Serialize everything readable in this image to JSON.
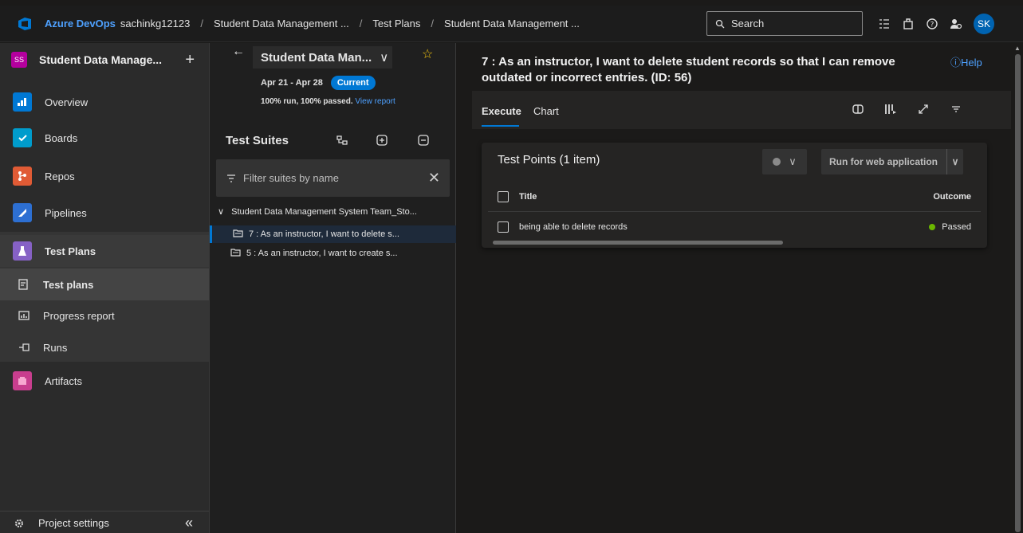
{
  "topbar": {
    "brand": "Azure DevOps",
    "org": "sachinkg12123",
    "breadcrumb": [
      "Student Data Management ...",
      "Test Plans",
      "Student Data Management ..."
    ],
    "search_placeholder": "Search",
    "avatar_initials": "SK"
  },
  "sidebar": {
    "project_badge": "SS",
    "project_name": "Student Data Manage...",
    "items": [
      {
        "label": "Overview",
        "icon": "overview-icon",
        "color": "#0078d4"
      },
      {
        "label": "Boards",
        "icon": "boards-icon",
        "color": "#009ccc"
      },
      {
        "label": "Repos",
        "icon": "repos-icon",
        "color": "#e05b35"
      },
      {
        "label": "Pipelines",
        "icon": "pipelines-icon",
        "color": "#2d6fd2"
      },
      {
        "label": "Test Plans",
        "icon": "test-plans-icon",
        "color": "#8661c5"
      },
      {
        "label": "Test plans",
        "icon": "test-plans-sub-icon"
      },
      {
        "label": "Progress report",
        "icon": "progress-report-icon"
      },
      {
        "label": "Runs",
        "icon": "runs-icon"
      },
      {
        "label": "Artifacts",
        "icon": "artifacts-icon",
        "color": "#c83e8e"
      }
    ],
    "settings_label": "Project settings",
    "collapse_glyph": "«"
  },
  "plan": {
    "name": "Student Data Man...",
    "dates": "Apr 21 - Apr 28",
    "current_badge": "Current",
    "run_summary": "100% run, 100% passed.",
    "view_report": "View report"
  },
  "suites": {
    "heading": "Test Suites",
    "filter_placeholder": "Filter suites by name",
    "root": "Student Data Management System Team_Sto...",
    "children": [
      "7 : As an instructor, I want to delete s...",
      "5 : As an instructor, I want to create s..."
    ]
  },
  "main": {
    "title": "7 : As an instructor, I want to delete student records so that I can remove outdated or incorrect entries. (ID: 56)",
    "help": "Help",
    "tabs": [
      "Execute",
      "Chart"
    ],
    "card_title": "Test Points (1 item)",
    "run_button": "Run for web application",
    "col_title": "Title",
    "col_outcome": "Outcome",
    "rows": [
      {
        "title": "being able to delete records",
        "outcome": "Passed"
      }
    ],
    "passed_color": "#6bb700"
  }
}
